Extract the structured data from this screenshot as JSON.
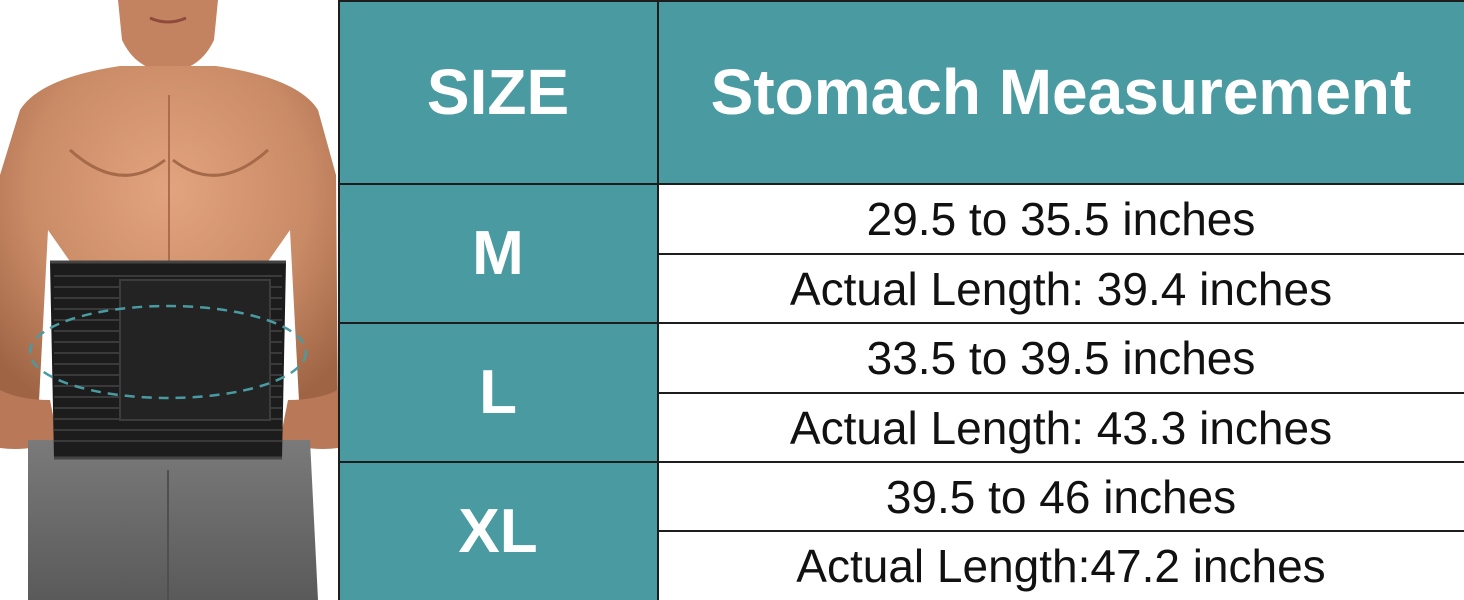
{
  "table": {
    "header": {
      "size": "SIZE",
      "measurement": "Stomach Measurement"
    },
    "rows": [
      {
        "size": "M",
        "range": "29.5 to 35.5 inches",
        "actual": "Actual Length: 39.4 inches"
      },
      {
        "size": "L",
        "range": "33.5 to 39.5 inches",
        "actual": "Actual Length: 43.3 inches"
      },
      {
        "size": "XL",
        "range": "39.5 to 46 inches",
        "actual": "Actual Length:47.2 inches"
      }
    ]
  },
  "colors": {
    "teal": "#4a9ba1",
    "border": "#1d1d1d",
    "belt": "#1c1c1c",
    "skin": "#c98a66",
    "shorts": "#6e6e6e"
  }
}
